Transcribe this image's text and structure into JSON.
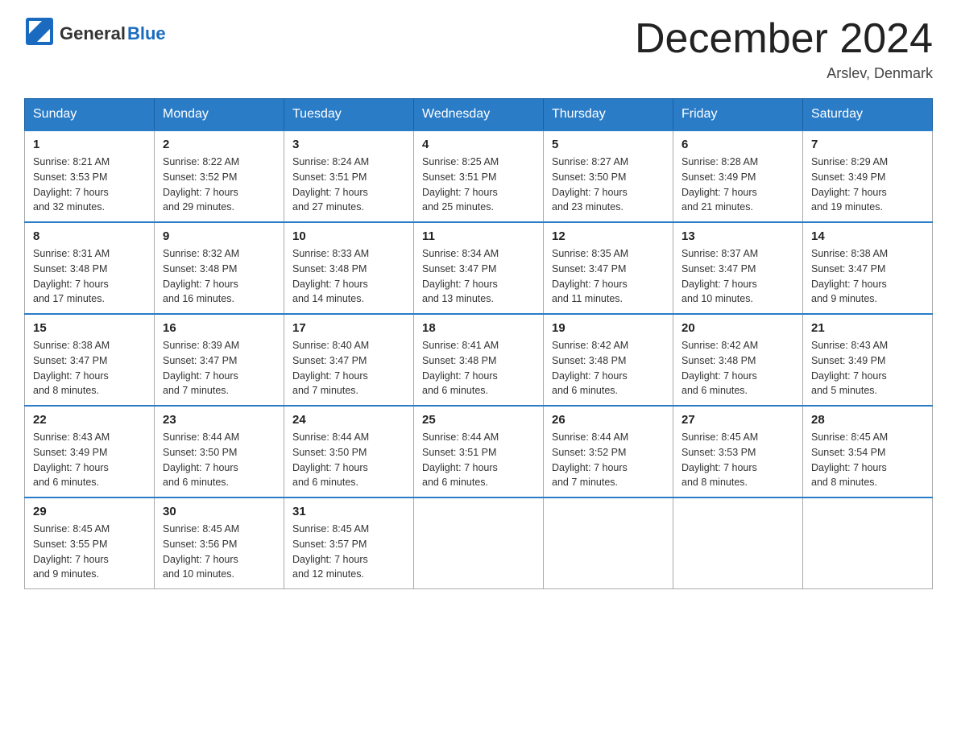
{
  "header": {
    "logo_general": "General",
    "logo_blue": "Blue",
    "month_title": "December 2024",
    "location": "Arslev, Denmark"
  },
  "days_of_week": [
    "Sunday",
    "Monday",
    "Tuesday",
    "Wednesday",
    "Thursday",
    "Friday",
    "Saturday"
  ],
  "weeks": [
    [
      {
        "day": "1",
        "sunrise": "8:21 AM",
        "sunset": "3:53 PM",
        "daylight": "7 hours and 32 minutes."
      },
      {
        "day": "2",
        "sunrise": "8:22 AM",
        "sunset": "3:52 PM",
        "daylight": "7 hours and 29 minutes."
      },
      {
        "day": "3",
        "sunrise": "8:24 AM",
        "sunset": "3:51 PM",
        "daylight": "7 hours and 27 minutes."
      },
      {
        "day": "4",
        "sunrise": "8:25 AM",
        "sunset": "3:51 PM",
        "daylight": "7 hours and 25 minutes."
      },
      {
        "day": "5",
        "sunrise": "8:27 AM",
        "sunset": "3:50 PM",
        "daylight": "7 hours and 23 minutes."
      },
      {
        "day": "6",
        "sunrise": "8:28 AM",
        "sunset": "3:49 PM",
        "daylight": "7 hours and 21 minutes."
      },
      {
        "day": "7",
        "sunrise": "8:29 AM",
        "sunset": "3:49 PM",
        "daylight": "7 hours and 19 minutes."
      }
    ],
    [
      {
        "day": "8",
        "sunrise": "8:31 AM",
        "sunset": "3:48 PM",
        "daylight": "7 hours and 17 minutes."
      },
      {
        "day": "9",
        "sunrise": "8:32 AM",
        "sunset": "3:48 PM",
        "daylight": "7 hours and 16 minutes."
      },
      {
        "day": "10",
        "sunrise": "8:33 AM",
        "sunset": "3:48 PM",
        "daylight": "7 hours and 14 minutes."
      },
      {
        "day": "11",
        "sunrise": "8:34 AM",
        "sunset": "3:47 PM",
        "daylight": "7 hours and 13 minutes."
      },
      {
        "day": "12",
        "sunrise": "8:35 AM",
        "sunset": "3:47 PM",
        "daylight": "7 hours and 11 minutes."
      },
      {
        "day": "13",
        "sunrise": "8:37 AM",
        "sunset": "3:47 PM",
        "daylight": "7 hours and 10 minutes."
      },
      {
        "day": "14",
        "sunrise": "8:38 AM",
        "sunset": "3:47 PM",
        "daylight": "7 hours and 9 minutes."
      }
    ],
    [
      {
        "day": "15",
        "sunrise": "8:38 AM",
        "sunset": "3:47 PM",
        "daylight": "7 hours and 8 minutes."
      },
      {
        "day": "16",
        "sunrise": "8:39 AM",
        "sunset": "3:47 PM",
        "daylight": "7 hours and 7 minutes."
      },
      {
        "day": "17",
        "sunrise": "8:40 AM",
        "sunset": "3:47 PM",
        "daylight": "7 hours and 7 minutes."
      },
      {
        "day": "18",
        "sunrise": "8:41 AM",
        "sunset": "3:48 PM",
        "daylight": "7 hours and 6 minutes."
      },
      {
        "day": "19",
        "sunrise": "8:42 AM",
        "sunset": "3:48 PM",
        "daylight": "7 hours and 6 minutes."
      },
      {
        "day": "20",
        "sunrise": "8:42 AM",
        "sunset": "3:48 PM",
        "daylight": "7 hours and 6 minutes."
      },
      {
        "day": "21",
        "sunrise": "8:43 AM",
        "sunset": "3:49 PM",
        "daylight": "7 hours and 5 minutes."
      }
    ],
    [
      {
        "day": "22",
        "sunrise": "8:43 AM",
        "sunset": "3:49 PM",
        "daylight": "7 hours and 6 minutes."
      },
      {
        "day": "23",
        "sunrise": "8:44 AM",
        "sunset": "3:50 PM",
        "daylight": "7 hours and 6 minutes."
      },
      {
        "day": "24",
        "sunrise": "8:44 AM",
        "sunset": "3:50 PM",
        "daylight": "7 hours and 6 minutes."
      },
      {
        "day": "25",
        "sunrise": "8:44 AM",
        "sunset": "3:51 PM",
        "daylight": "7 hours and 6 minutes."
      },
      {
        "day": "26",
        "sunrise": "8:44 AM",
        "sunset": "3:52 PM",
        "daylight": "7 hours and 7 minutes."
      },
      {
        "day": "27",
        "sunrise": "8:45 AM",
        "sunset": "3:53 PM",
        "daylight": "7 hours and 8 minutes."
      },
      {
        "day": "28",
        "sunrise": "8:45 AM",
        "sunset": "3:54 PM",
        "daylight": "7 hours and 8 minutes."
      }
    ],
    [
      {
        "day": "29",
        "sunrise": "8:45 AM",
        "sunset": "3:55 PM",
        "daylight": "7 hours and 9 minutes."
      },
      {
        "day": "30",
        "sunrise": "8:45 AM",
        "sunset": "3:56 PM",
        "daylight": "7 hours and 10 minutes."
      },
      {
        "day": "31",
        "sunrise": "8:45 AM",
        "sunset": "3:57 PM",
        "daylight": "7 hours and 12 minutes."
      },
      null,
      null,
      null,
      null
    ]
  ],
  "labels": {
    "sunrise": "Sunrise:",
    "sunset": "Sunset:",
    "daylight": "Daylight:"
  }
}
